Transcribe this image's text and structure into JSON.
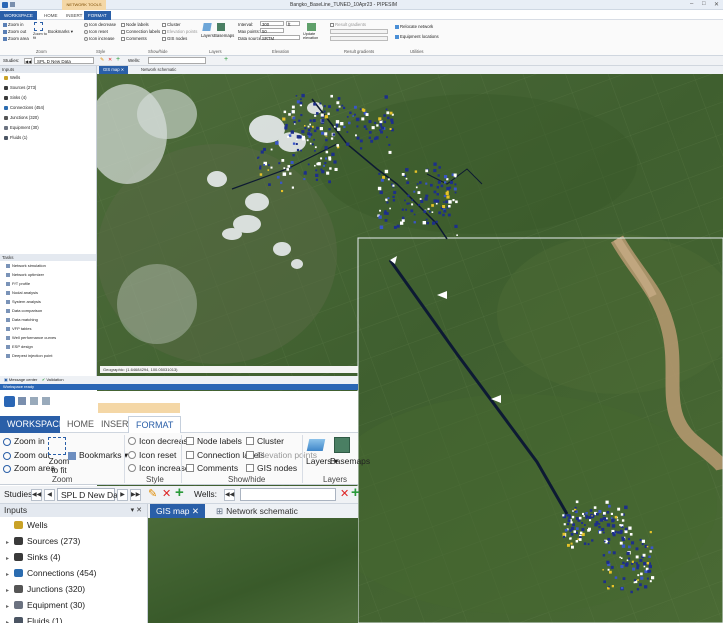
{
  "window": {
    "title": "Bangko_BaseLine_TUNED_10Apr23 - PIPESIM",
    "context_tab": "NETWORK TOOLS"
  },
  "tabs": [
    "WORKSPACE",
    "HOME",
    "INSERT",
    "FORMAT"
  ],
  "ribbon": {
    "zoom": {
      "zoom_in": "Zoom in",
      "zoom_out": "Zoom out",
      "zoom_area": "Zoom area",
      "zoom_to_fit": "Zoom to fit",
      "bookmarks": "Bookmarks",
      "group": "Zoom"
    },
    "style": {
      "icon_decrease": "Icon decrease",
      "icon_reset": "Icon reset",
      "icon_increase": "Icon increase",
      "group": "Style"
    },
    "show_hide": {
      "node_labels": "Node labels",
      "connection_labels": "Connection labels",
      "comments": "Comments",
      "cluster": "Cluster",
      "elevation_points": "Elevation points",
      "gis_nodes": "GIS nodes",
      "group": "Show/hide"
    },
    "layers": {
      "layers": "Layers",
      "basemaps": "Basemaps",
      "group": "Layers"
    },
    "elevation": {
      "interval_label": "Interval:",
      "interval_value": "300",
      "interval_unit": "ft",
      "max_points_label": "Max points:",
      "max_points_value": "50",
      "data_source_label": "Data source:",
      "data_source_value": "SRTM",
      "update_elevation": "Update elevation",
      "group": "Elevation"
    },
    "result_gradients": {
      "result_gradients": "Result gradients",
      "group": "Result gradients"
    },
    "utilities": {
      "relocate_network": "Relocate network",
      "equipment_locations": "Equipment locations",
      "group": "Utilities"
    }
  },
  "studies_bar": {
    "studies_label": "Studies:",
    "study_value": "SPL D New Data",
    "wells_label": "Wells:"
  },
  "inputs_panel": {
    "title": "Inputs",
    "items": [
      {
        "label": "Wells",
        "color": "#c9a227"
      },
      {
        "label": "Sources (273)",
        "color": "#3a3a3a"
      },
      {
        "label": "Sinks (4)",
        "color": "#3a3a3a"
      },
      {
        "label": "Connections (454)",
        "color": "#2b6cb0"
      },
      {
        "label": "Junctions (320)",
        "color": "#555555"
      },
      {
        "label": "Equipment (30)",
        "color": "#6b7280"
      },
      {
        "label": "Fluids (1)",
        "color": "#4b5563"
      }
    ]
  },
  "tasks_panel": {
    "title": "Tasks",
    "items": [
      "Network simulation",
      "Network optimizer",
      "P/T profile",
      "Nodal analysis",
      "System analysis",
      "Data comparison",
      "Data matching",
      "VFP tables",
      "Well performance curves",
      "ESP design",
      "Deepest injection point"
    ]
  },
  "map_tabs": [
    "GIS map",
    "Network schematic"
  ],
  "coords": "Geographic: (1.64684294, 100.05031013)",
  "status": {
    "message_center": "Message center",
    "validation": "Validation",
    "ready": "Workspace ready"
  },
  "colors": {
    "ribbon_blue": "#2a5fa8",
    "status_blue": "#2a66b5",
    "context_orange": "#f4d7a6"
  }
}
